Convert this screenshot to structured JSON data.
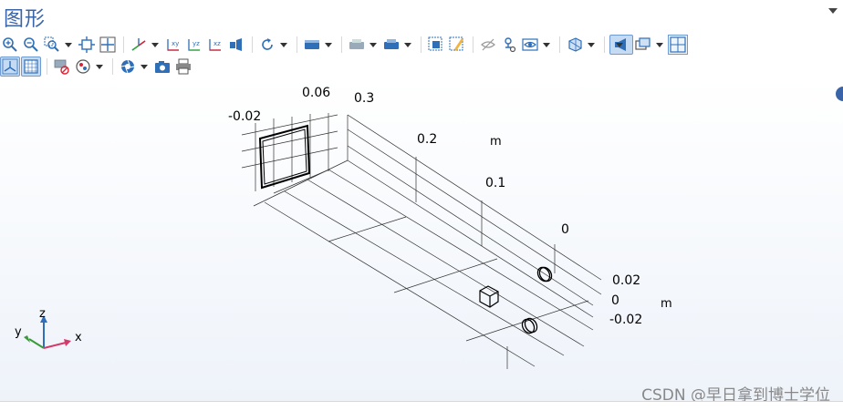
{
  "window": {
    "title": "图形"
  },
  "toolbar_row1": [
    {
      "name": "zoom-in-icon"
    },
    {
      "name": "zoom-out-icon"
    },
    {
      "name": "zoom-box-icon",
      "dropdown": true
    },
    {
      "name": "zoom-extents-icon"
    },
    {
      "name": "zoom-selection-icon"
    },
    {
      "name": "view-axes-icon",
      "dropdown": true
    },
    {
      "name": "view-xy-icon"
    },
    {
      "name": "view-yz-icon"
    },
    {
      "name": "view-xz-icon"
    },
    {
      "name": "camera-view-icon"
    },
    {
      "name": "rotate-icon",
      "dropdown": true
    },
    {
      "name": "render-mode-icon",
      "dropdown": true
    },
    {
      "name": "select-mode-icon",
      "dropdown": true
    },
    {
      "name": "select-object-icon",
      "dropdown": true
    },
    {
      "name": "select-box-icon"
    },
    {
      "name": "clear-selection-icon"
    },
    {
      "name": "hide-icon"
    },
    {
      "name": "link-icon"
    },
    {
      "name": "eye-icon",
      "dropdown": true
    },
    {
      "name": "transparency-icon",
      "dropdown": true
    },
    {
      "name": "scene-light-icon",
      "dropdown": true,
      "active": true
    },
    {
      "name": "views-icon",
      "dropdown": true
    },
    {
      "name": "grid-view-icon"
    }
  ],
  "toolbar_row2": [
    {
      "name": "reset-view-icon",
      "active": true
    },
    {
      "name": "grid-toggle-icon",
      "active": true
    },
    {
      "name": "clear-layers-icon"
    },
    {
      "name": "color-table-icon",
      "dropdown": true
    },
    {
      "name": "aperture-icon",
      "dropdown": true
    },
    {
      "name": "snapshot-camera-icon"
    },
    {
      "name": "print-icon"
    }
  ],
  "axis_labels": {
    "z_ticks": [
      "0.06",
      "-0.02"
    ],
    "x_ticks": [
      "0.3",
      "0.2",
      "0.1",
      "0"
    ],
    "x_unit": "m",
    "y_ticks": [
      "0.02",
      "0",
      "-0.02"
    ],
    "y_unit": "m"
  },
  "triad": {
    "x": "x",
    "y": "y",
    "z": "z"
  },
  "watermark": "CSDN @早日拿到博士学位"
}
